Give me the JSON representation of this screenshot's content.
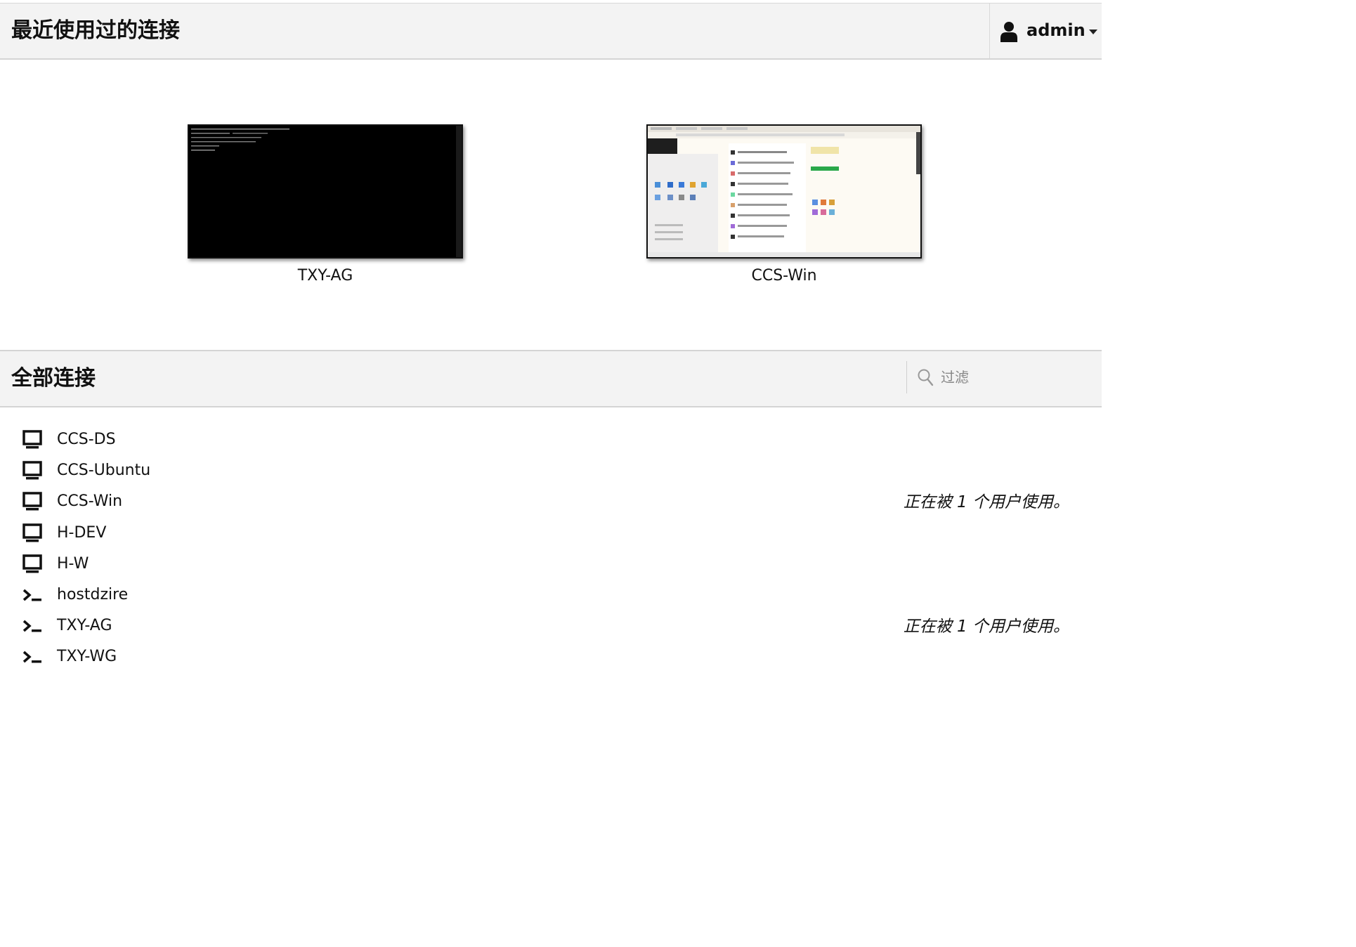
{
  "recent": {
    "title": "最近使用过的连接",
    "items": [
      {
        "name": "TXY-AG",
        "preview": "terminal"
      },
      {
        "name": "CCS-Win",
        "preview": "desktop"
      }
    ]
  },
  "user_menu": {
    "username": "admin",
    "icon": "user-icon",
    "caret_icon": "caret-down-icon"
  },
  "all_connections": {
    "title": "全部连接",
    "filter": {
      "placeholder": "过滤",
      "value": "",
      "icon": "search-icon"
    },
    "items": [
      {
        "name": "CCS-DS",
        "protocol": "desktop",
        "icon": "desktop-icon",
        "status": ""
      },
      {
        "name": "CCS-Ubuntu",
        "protocol": "desktop",
        "icon": "desktop-icon",
        "status": ""
      },
      {
        "name": "CCS-Win",
        "protocol": "desktop",
        "icon": "desktop-icon",
        "status": "正在被 1 个用户使用。"
      },
      {
        "name": "H-DEV",
        "protocol": "desktop",
        "icon": "desktop-icon",
        "status": ""
      },
      {
        "name": "H-W",
        "protocol": "desktop",
        "icon": "desktop-icon",
        "status": ""
      },
      {
        "name": "hostdzire",
        "protocol": "terminal",
        "icon": "terminal-icon",
        "status": ""
      },
      {
        "name": "TXY-AG",
        "protocol": "terminal",
        "icon": "terminal-icon",
        "status": "正在被 1 个用户使用。"
      },
      {
        "name": "TXY-WG",
        "protocol": "terminal",
        "icon": "terminal-icon",
        "status": ""
      }
    ]
  },
  "colors": {
    "header_bg": "#f3f3f3",
    "border": "#d4d4d4",
    "text": "#111111"
  }
}
